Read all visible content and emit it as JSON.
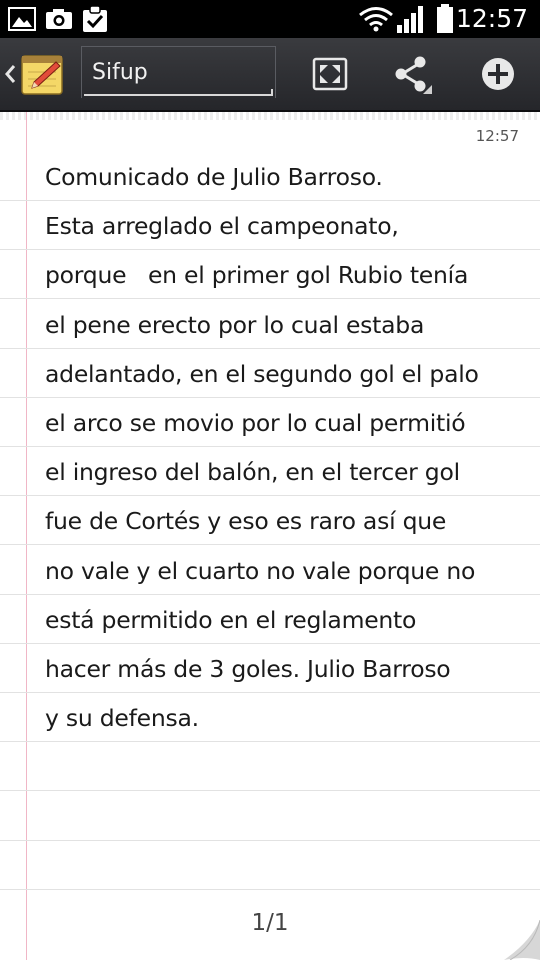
{
  "status_bar": {
    "time": "12:57",
    "icons": [
      "gallery-icon",
      "camera-icon",
      "clipboard-check-icon",
      "wifi-icon",
      "signal-icon",
      "battery-icon"
    ]
  },
  "action_bar": {
    "title": "Sifup",
    "icons": [
      "back-chevron-icon",
      "memo-app-icon",
      "fit-screen-icon",
      "share-icon",
      "add-icon"
    ]
  },
  "note": {
    "timestamp": "12:57",
    "lines": [
      "Comunicado de Julio Barroso.",
      "Esta arreglado el campeonato,",
      "porque   en el primer gol Rubio tenía",
      "el pene erecto por lo cual estaba",
      "adelantado, en el segundo gol el palo",
      "el arco se movio por lo cual permitió",
      "el ingreso del balón, en el tercer gol",
      "fue de Cortés y eso es raro así que",
      "no vale y el cuarto no vale porque no",
      "está permitido en el reglamento",
      "hacer más de 3 goles. Julio Barroso",
      "y su defensa."
    ],
    "page_indicator": "1/1"
  },
  "colors": {
    "status_bg": "#000000",
    "action_bar_bg": "#2f3034",
    "margin_line": "#f0b6c6",
    "rule_line": "#e2e2e2",
    "text": "#1a1a1a"
  }
}
